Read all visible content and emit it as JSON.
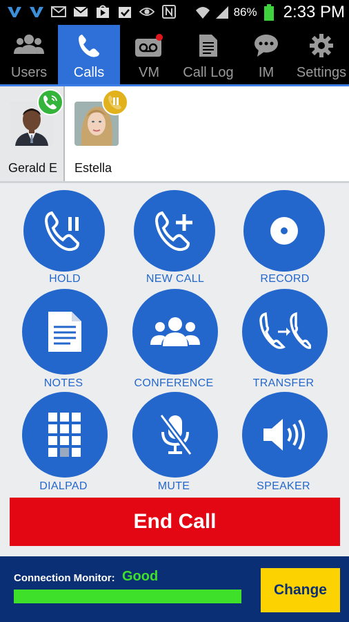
{
  "status_bar": {
    "battery_percent": "86%",
    "time": "2:33 PM",
    "icons": [
      "app-v-icon",
      "app-v-icon",
      "voicemail-email-icon",
      "gmail-icon",
      "play-store-icon",
      "task-icon",
      "eye-icon",
      "nfc-icon",
      "wifi-icon",
      "signal-icon",
      "battery-icon"
    ]
  },
  "tabs": [
    {
      "label": "Users",
      "icon": "users-icon",
      "active": false
    },
    {
      "label": "Calls",
      "icon": "phone-icon",
      "active": true
    },
    {
      "label": "VM",
      "icon": "voicemail-icon",
      "active": false,
      "has_notification": true
    },
    {
      "label": "Call Log",
      "icon": "document-icon",
      "active": false
    },
    {
      "label": "IM",
      "icon": "chat-icon",
      "active": false
    },
    {
      "label": "Settings",
      "icon": "gear-icon",
      "active": false
    }
  ],
  "calls": [
    {
      "name": "Gerald E",
      "status": "active",
      "badge_icon": "phone-active-icon",
      "badge_color": "#35b43c"
    },
    {
      "name": "Estella",
      "status": "on-hold",
      "badge_icon": "hold-icon",
      "badge_color": "#e2b21c"
    }
  ],
  "actions": [
    {
      "label": "HOLD",
      "icon": "phone-hold-icon"
    },
    {
      "label": "NEW CALL",
      "icon": "phone-add-icon"
    },
    {
      "label": "RECORD",
      "icon": "record-icon"
    },
    {
      "label": "NOTES",
      "icon": "notes-icon"
    },
    {
      "label": "CONFERENCE",
      "icon": "conference-icon"
    },
    {
      "label": "TRANSFER",
      "icon": "transfer-icon"
    },
    {
      "label": "DIALPAD",
      "icon": "dialpad-icon"
    },
    {
      "label": "MUTE",
      "icon": "mic-muted-icon"
    },
    {
      "label": "SPEAKER",
      "icon": "speaker-icon"
    }
  ],
  "end_call": {
    "label": "End Call",
    "color": "#e20712"
  },
  "connection_monitor": {
    "label": "Connection Monitor:",
    "value": "Good",
    "quality_level": 1.0,
    "change_label": "Change"
  },
  "colors": {
    "accent": "#2467cc",
    "active_tab": "#2f6fd8",
    "monitor_bg": "#0b2f75",
    "good": "#3ee02a",
    "change_button": "#fcd200"
  }
}
